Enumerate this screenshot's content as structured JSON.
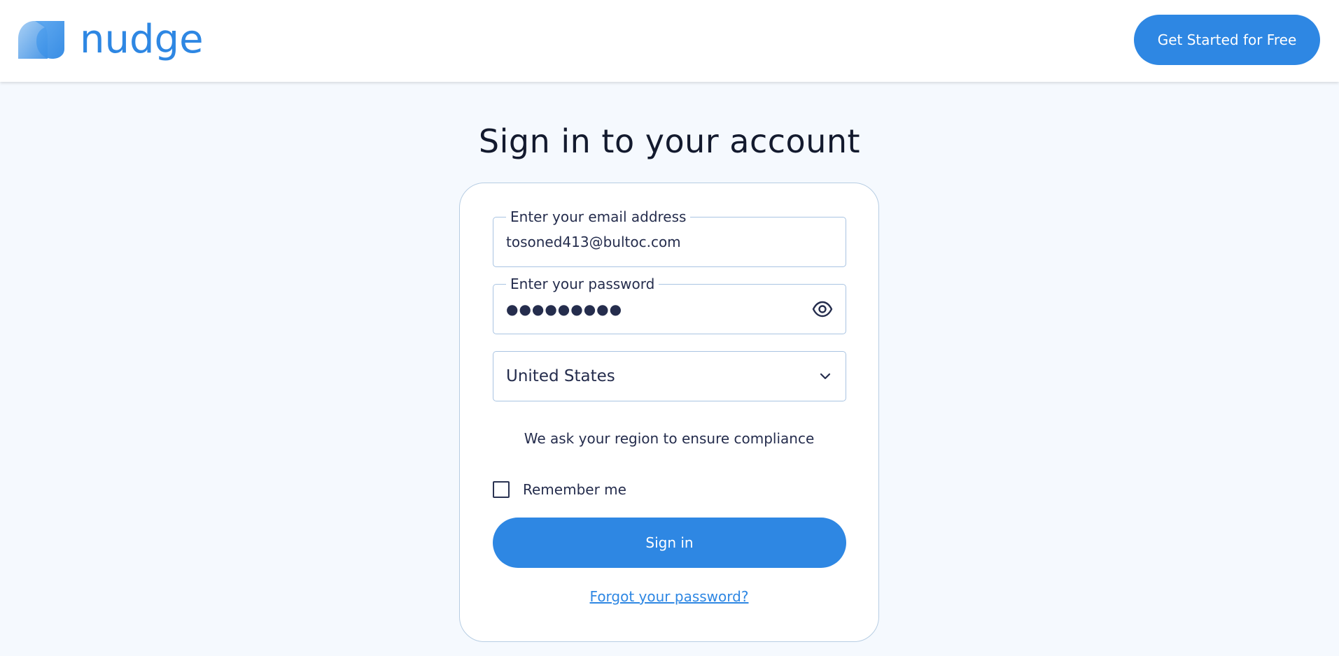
{
  "header": {
    "brand_name": "nudge",
    "cta_label": "Get Started for Free"
  },
  "main": {
    "title": "Sign in to your account"
  },
  "form": {
    "email": {
      "label": "Enter your email address",
      "value": "tosoned413@bultoc.com"
    },
    "password": {
      "label": "Enter your password",
      "masked_value": "●●●●●●●●●"
    },
    "region": {
      "selected": "United States"
    },
    "compliance_note": "We ask your region to ensure compliance",
    "remember_label": "Remember me",
    "remember_checked": false,
    "signin_label": "Sign in",
    "forgot_label": "Forgot your password?"
  },
  "icons": {
    "logo": "nudge-logo-mark",
    "password_toggle": "eye-icon",
    "region_dropdown": "chevron-down-icon"
  },
  "colors": {
    "accent": "#2e87e3",
    "page_background": "#f5f9fe",
    "text": "#252d4d"
  }
}
